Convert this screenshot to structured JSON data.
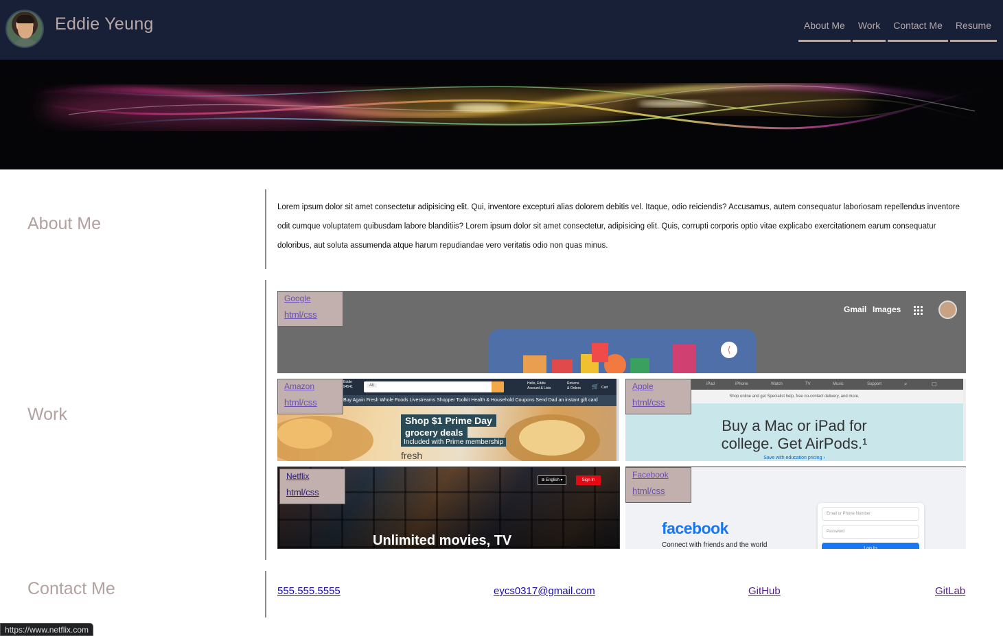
{
  "header": {
    "name": "Eddie Yeung",
    "nav": [
      "About Me",
      "Work",
      "Contact Me",
      "Resume"
    ]
  },
  "about": {
    "title": "About Me",
    "text": "Lorem ipsum dolor sit amet consectetur adipisicing elit. Qui, inventore excepturi alias dolorem debitis vel. Itaque, odio reiciendis? Accusamus, autem consequatur laboriosam repellendus inventore odit cumque voluptatem quibusdam labore blanditiis? Lorem ipsum dolor sit amet consectetur, adipisicing elit. Quis, corrupti corporis optio vitae explicabo exercitationem earum consequatur doloribus, aut soluta assumenda atque harum repudiandae vero veritatis odio non quas minus."
  },
  "work": {
    "title": "Work",
    "projects": [
      {
        "name": "Google",
        "tech": "html/css",
        "preview": {
          "links": [
            "Gmail",
            "Images"
          ]
        }
      },
      {
        "name": "Amazon",
        "tech": "html/css",
        "preview": {
          "account": "Hello, Eddie\nAccount & Lists",
          "orders": "Returns\n& Orders",
          "cart": "Cart",
          "deliver": "Eddie\n94541",
          "search_dept": "All",
          "subnav": "Buy Again   Fresh   Whole Foods   Livestreams   Shopper Toolkit   Health & Household   Coupons            Send Dad an instant gift card",
          "promo_1": "Shop $1 Prime Day",
          "promo_2": "grocery deals",
          "promo_3": "Included with Prime membership",
          "promo_4": "fresh"
        }
      },
      {
        "name": "Apple",
        "tech": "html/css",
        "preview": {
          "nav": [
            "iPad",
            "iPhone",
            "Watch",
            "TV",
            "Music",
            "Support"
          ],
          "strip": "Shop online and get Specialist help, free no-contact delivery, and more.",
          "headline_1": "Buy a Mac or iPad for",
          "headline_2": "college. Get AirPods.¹",
          "cta": "Save with education pricing ›"
        }
      },
      {
        "name": "Netflix",
        "tech": "html/css",
        "preview": {
          "language": "⊕ English ▾",
          "signin": "Sign In",
          "headline": "Unlimited movies, TV"
        }
      },
      {
        "name": "Facebook",
        "tech": "html/css",
        "preview": {
          "logo": "facebook",
          "tagline": "Connect with friends and the world",
          "email_placeholder": "Email or Phone Number",
          "password_placeholder": "Password",
          "login": "Log In"
        }
      }
    ]
  },
  "contact": {
    "title": "Contact Me",
    "phone": "555.555.5555",
    "email": "eycs0317@gmail.com",
    "github": "GitHub",
    "gitlab": "GitLab"
  },
  "status_url": "https://www.netflix.com",
  "colors": {
    "header_bg": "#172037",
    "accent_text": "#b7a8a6",
    "tag_bg": "#c1b0ae",
    "link": "#1a0dab",
    "visited": "#551a8b"
  }
}
